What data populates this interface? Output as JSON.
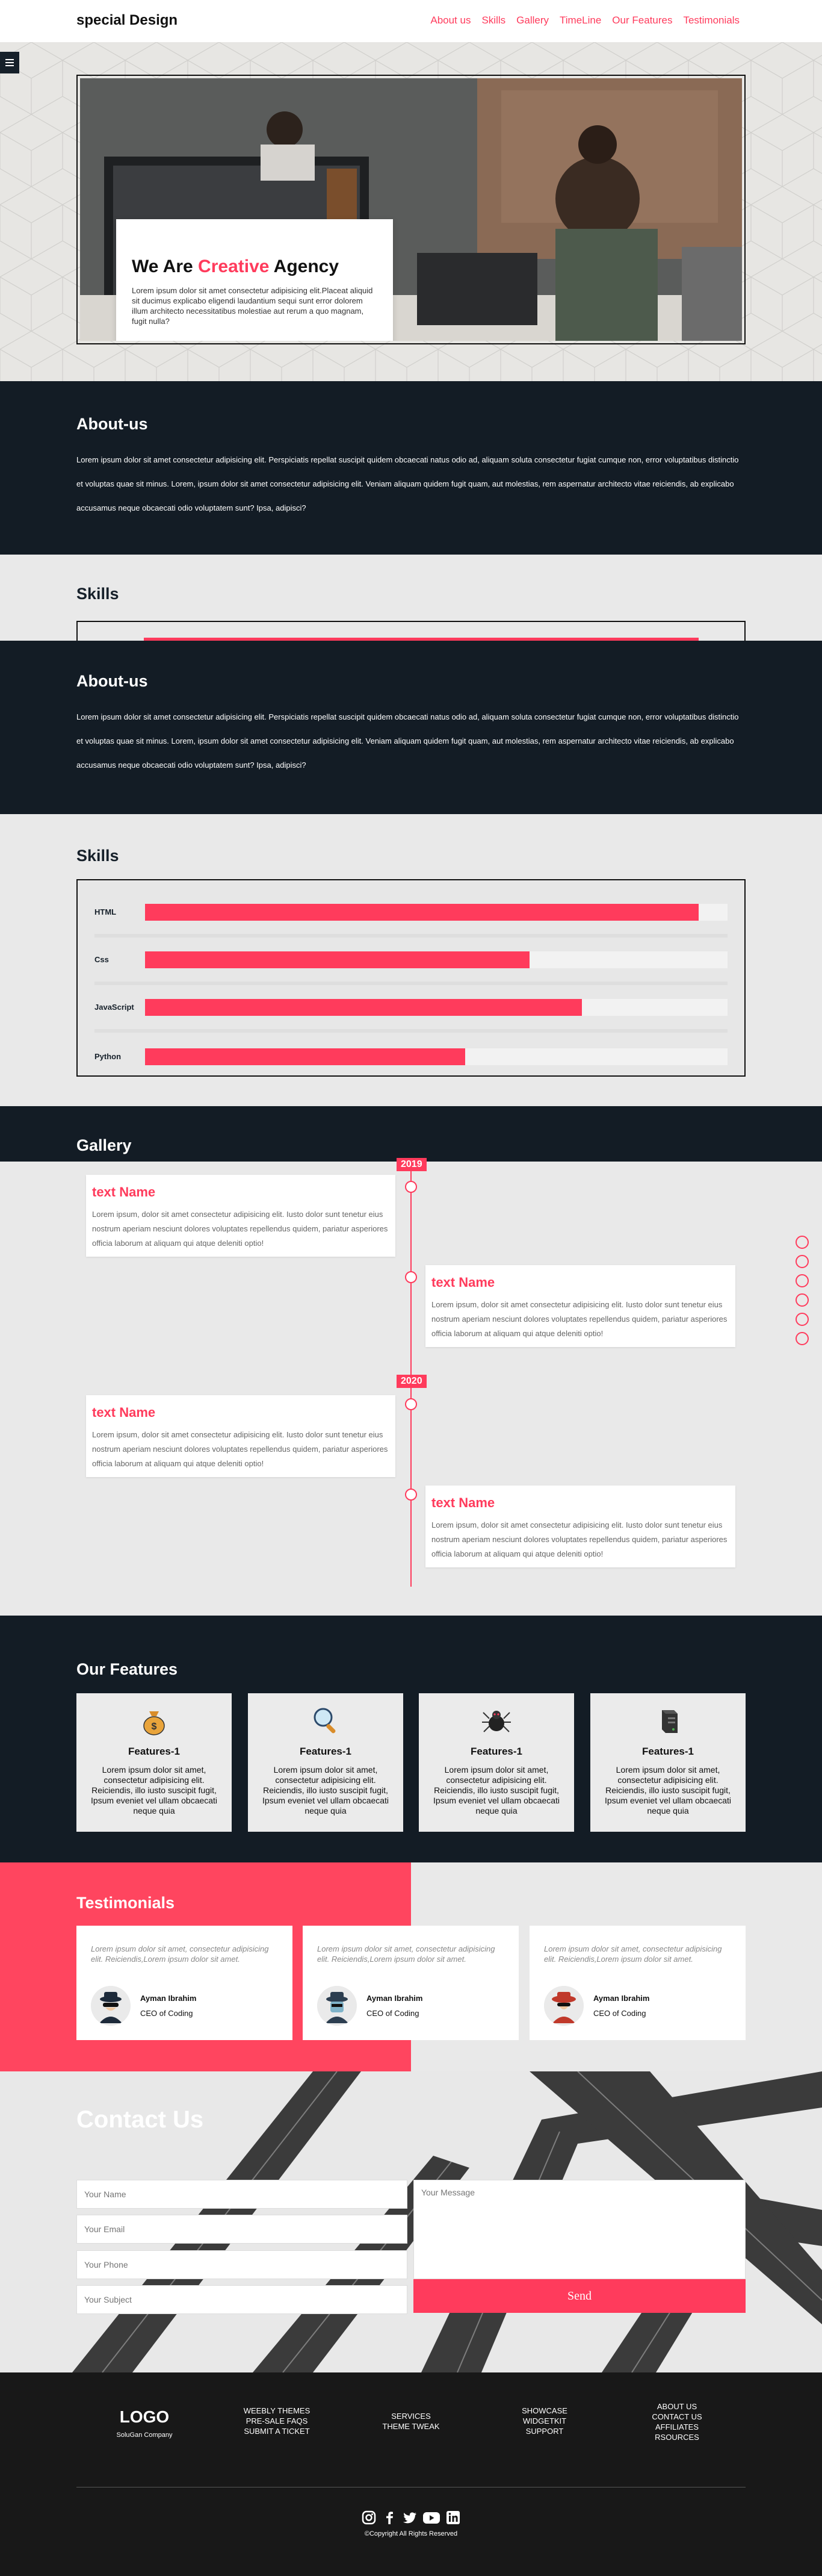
{
  "header": {
    "logo": "special Design",
    "nav": [
      "About us",
      "Skills",
      "Gallery",
      "TimeLine",
      "Our Features",
      "Testimonials"
    ]
  },
  "hero": {
    "title_prefix": "We Are ",
    "title_highlight": "Creative",
    "title_suffix": " Agency",
    "text": "Lorem ipsum dolor sit amet consectetur adipisicing elit.Placeat aliquid sit ducimus explicabo eligendi laudantium sequi sunt error dolorem illum architecto necessitatibus molestiae aut rerum a quo magnam, fugit nulla?"
  },
  "about": {
    "title": "About-us",
    "text": "Lorem ipsum dolor sit amet consectetur adipisicing elit. Perspiciatis repellat suscipit quidem obcaecati natus odio ad, aliquam soluta consectetur fugiat cumque non, error voluptatibus distinctio et voluptas quae sit minus. Lorem, ipsum dolor sit amet consectetur adipisicing elit. Veniam aliquam quidem fugit quam, aut molestias, rem aspernatur architecto vitae reiciendis, ab explicabo accusamus neque obcaecati odio voluptatem sunt? Ipsa, adipisci?"
  },
  "skills": {
    "title": "Skills",
    "items": [
      {
        "name": "HTML",
        "level": 95
      },
      {
        "name": "Css",
        "level": 66
      },
      {
        "name": "JavaScript",
        "level": 75
      },
      {
        "name": "Python",
        "level": 55
      }
    ]
  },
  "gallery": {
    "title": "Gallery",
    "years": [
      "2019",
      "2020"
    ],
    "events": [
      {
        "title": "text Name",
        "text": "Lorem ipsum, dolor sit amet consectetur adipisicing elit. Iusto dolor sunt tenetur eius nostrum aperiam nesciunt dolores voluptates repellendus quidem, pariatur asperiores officia laborum at aliquam qui atque deleniti optio!"
      },
      {
        "title": "text Name",
        "text": "Lorem ipsum, dolor sit amet consectetur adipisicing elit. Iusto dolor sunt tenetur eius nostrum aperiam nesciunt dolores voluptates repellendus quidem, pariatur asperiores officia laborum at aliquam qui atque deleniti optio!"
      },
      {
        "title": "text Name",
        "text": "Lorem ipsum, dolor sit amet consectetur adipisicing elit. Iusto dolor sunt tenetur eius nostrum aperiam nesciunt dolores voluptates repellendus quidem, pariatur asperiores officia laborum at aliquam qui atque deleniti optio!"
      },
      {
        "title": "text Name",
        "text": "Lorem ipsum, dolor sit amet consectetur adipisicing elit. Iusto dolor sunt tenetur eius nostrum aperiam nesciunt dolores voluptates repellendus quidem, pariatur asperiores officia laborum at aliquam qui atque deleniti optio!"
      }
    ]
  },
  "features": {
    "title": "Our Features",
    "items": [
      {
        "title": "Features-1",
        "icon": "money-bag-icon",
        "text": "Lorem ipsum dolor sit amet, consectetur adipisicing elit. Reiciendis, illo iusto suscipit fugit, Ipsum eveniet vel ullam obcaecati neque quia"
      },
      {
        "title": "Features-1",
        "icon": "magnifier-icon",
        "text": "Lorem ipsum dolor sit amet, consectetur adipisicing elit. Reiciendis, illo iusto suscipit fugit, Ipsum eveniet vel ullam obcaecati neque quia"
      },
      {
        "title": "Features-1",
        "icon": "spider-icon",
        "text": "Lorem ipsum dolor sit amet, consectetur adipisicing elit. Reiciendis, illo iusto suscipit fugit, Ipsum eveniet vel ullam obcaecati neque quia"
      },
      {
        "title": "Features-1",
        "icon": "server-icon",
        "text": "Lorem ipsum dolor sit amet, consectetur adipisicing elit. Reiciendis, illo iusto suscipit fugit, Ipsum eveniet vel ullam obcaecati neque quia"
      }
    ]
  },
  "testimonials": {
    "title": "Testimonials",
    "items": [
      {
        "quote": "Lorem ipsum dolor sit amet, consectetur adipisicing elit. Reiciendis,Lorem ipsum dolor sit amet.",
        "name": "Ayman Ibrahim",
        "role": "CEO of Coding"
      },
      {
        "quote": "Lorem ipsum dolor sit amet, consectetur adipisicing elit. Reiciendis,Lorem ipsum dolor sit amet.",
        "name": "Ayman Ibrahim",
        "role": "CEO of Coding"
      },
      {
        "quote": "Lorem ipsum dolor sit amet, consectetur adipisicing elit. Reiciendis,Lorem ipsum dolor sit amet.",
        "name": "Ayman Ibrahim",
        "role": "CEO of Coding"
      }
    ]
  },
  "contact": {
    "title": "Contact Us",
    "name_placeholder": "Your Name",
    "email_placeholder": "Your Email",
    "phone_placeholder": "Your Phone",
    "subject_placeholder": "Your Subject",
    "message_placeholder": "Your Message",
    "send_label": "Send"
  },
  "footer": {
    "logo": "LOGO",
    "company": "SoluGan Company",
    "col1": [
      "WEEBLY THEMES",
      "PRE-SALE FAQS",
      "SUBMIT A TICKET"
    ],
    "col2": [
      "SERVICES",
      "THEME TWEAK"
    ],
    "col3": [
      "SHOWCASE",
      "WIDGETKIT",
      "SUPPORT"
    ],
    "col4": [
      "ABOUT US",
      "CONTACT US",
      "AFFILIATES",
      "RSOURCES"
    ],
    "copyright": "©Copyright All Rights Reserved"
  },
  "colors": {
    "accent": "#ff3b5c",
    "dark": "#131c25",
    "footer": "#181818"
  }
}
